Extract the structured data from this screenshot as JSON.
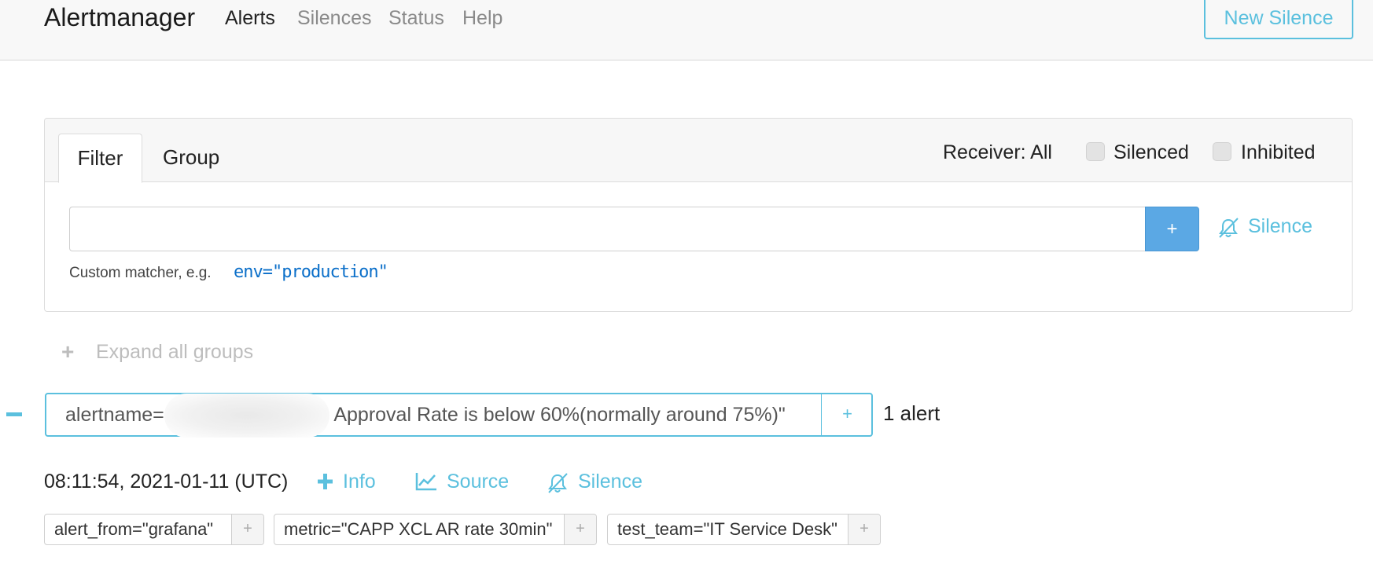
{
  "navbar": {
    "brand": "Alertmanager",
    "links": [
      {
        "label": "Alerts",
        "active": true
      },
      {
        "label": "Silences",
        "active": false
      },
      {
        "label": "Status",
        "active": false
      },
      {
        "label": "Help",
        "active": false
      }
    ],
    "new_silence_label": "New Silence"
  },
  "filter_card": {
    "tabs": [
      {
        "label": "Filter",
        "active": true
      },
      {
        "label": "Group",
        "active": false
      }
    ],
    "receiver_label": "Receiver: All",
    "silenced_label": "Silenced",
    "inhibited_label": "Inhibited",
    "silenced_checked": false,
    "inhibited_checked": false,
    "input_value": "",
    "add_button_label": "+",
    "silence_label": "Silence",
    "hint_text": "Custom matcher, e.g.",
    "hint_example": "env=\"production\""
  },
  "expand_all_label": "Expand all groups",
  "group": {
    "label_prefix": "alertname=",
    "label_suffix": " Approval Rate is below 60%(normally around 75%)\"",
    "add_label": "+",
    "alert_count": "1 alert"
  },
  "alert": {
    "timestamp": "08:11:54, 2021-01-11 (UTC)",
    "actions": {
      "info": "Info",
      "source": "Source",
      "silence": "Silence"
    },
    "labels": [
      {
        "text": "alert_from=\"grafana\"",
        "add": "+"
      },
      {
        "text": "metric=\"CAPP XCL AR rate 30min\"",
        "add": "+"
      },
      {
        "text": "test_team=\"IT Service Desk\"",
        "add": "+"
      }
    ]
  },
  "colors": {
    "accent": "#5bc0de",
    "primary_button": "#5ba8e4",
    "link_blue": "#0b6fc9",
    "navbar_bg": "#f8f8f8"
  },
  "icons": {
    "silence": "bell-slash-icon",
    "info": "plus-icon",
    "source": "chart-line-icon",
    "expand": "plus-icon",
    "collapse": "minus-icon"
  }
}
